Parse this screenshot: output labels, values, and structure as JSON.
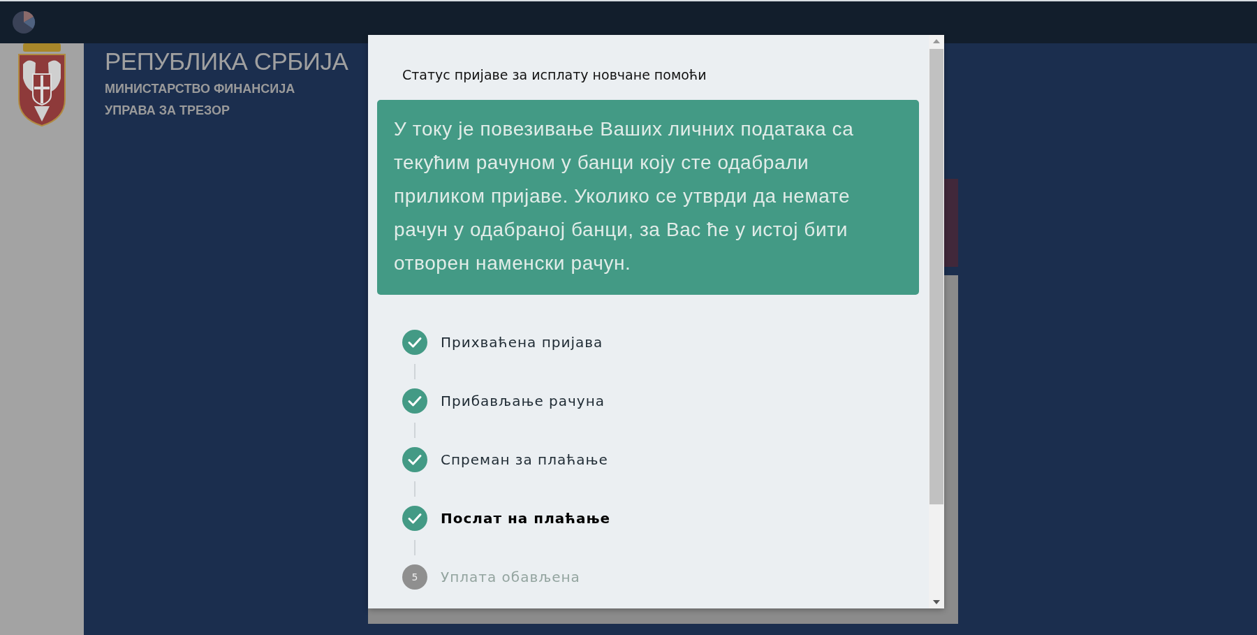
{
  "header": {
    "title": "РЕПУБЛИКА СРБИЈА",
    "subtitles": [
      "МИНИСТАРСТВО ФИНАНСИЈА",
      "УПРАВА ЗА ТРЕЗОР"
    ]
  },
  "modal": {
    "title": "Статус пријаве за исплату новчане помоћи",
    "message": "У току је повезивање Ваших личних података са текућим рачуном у банци коју сте одабрали приликом пријаве. Уколико се утврди да немате рачун у одабраној банци, за Вас ће у истој бити отворен наменски рачун.",
    "steps": [
      {
        "label": "Прихваћена пријава",
        "kind": "done",
        "current": false
      },
      {
        "label": "Прибављање рачуна",
        "kind": "done",
        "current": false
      },
      {
        "label": "Спреман за плаћање",
        "kind": "done",
        "current": false
      },
      {
        "label": "Послат на плаћање",
        "kind": "done",
        "current": true
      },
      {
        "label": "Уплата обављена",
        "kind": "pending",
        "number": "5",
        "current": false
      }
    ]
  }
}
